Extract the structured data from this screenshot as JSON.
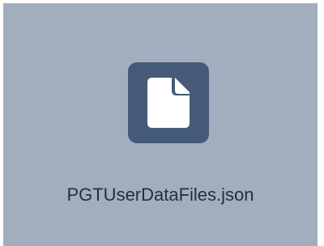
{
  "file": {
    "name": "PGTUserDataFiles.json",
    "icon": "file-icon"
  },
  "colors": {
    "tile_background": "#a2aebe",
    "icon_background": "#445a78",
    "icon_glyph": "#ffffff",
    "text": "#2a2e33"
  }
}
